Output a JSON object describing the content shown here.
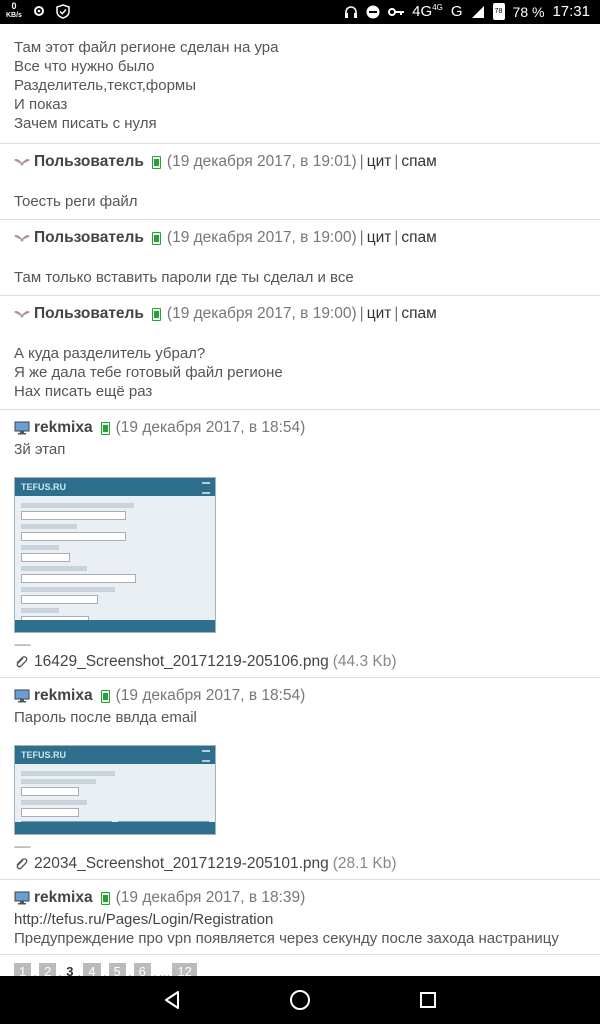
{
  "status_bar": {
    "speed_value": "0",
    "speed_unit": "KB/s",
    "network": "4G",
    "network_small": "4G",
    "carrier_letter": "G",
    "battery_level": "78",
    "battery_percent": "78 %",
    "time": "17:31",
    "icons": [
      "settings-icon",
      "shield-icon",
      "headphones-icon",
      "do-not-disturb-icon",
      "key-icon",
      "signal-icon",
      "battery-icon"
    ]
  },
  "posts": [
    {
      "text_lines": [
        "Там этот файл регионе сделан на ура",
        "Все что нужно было",
        "Разделитель,текст,формы",
        "И показ",
        "Зачем писать с нуля"
      ]
    },
    {
      "author": "Пользователь",
      "date": "(19 декабря 2017, в 19:01)",
      "actions": [
        "цит",
        "спам"
      ],
      "message_lines": [
        "Тоесть реги файл"
      ]
    },
    {
      "author": "Пользователь",
      "date": "(19 декабря 2017, в 19:00)",
      "actions": [
        "цит",
        "спам"
      ],
      "message_lines": [
        "Там только вставить пароли где ты сделал и все"
      ]
    },
    {
      "author": "Пользователь",
      "date": "(19 декабря 2017, в 19:00)",
      "actions": [
        "цит",
        "спам"
      ],
      "message_lines": [
        "А куда разделитель убрал?",
        "Я же дала тебе готовый файл регионе",
        "Нах писать ещё раз"
      ]
    },
    {
      "author": "rekmixa",
      "date": "(19 декабря 2017, в 18:54)",
      "message_lines": [
        "3й этап"
      ],
      "thumb_brand": "TEFUS.RU",
      "dashes": "------",
      "attachment_name": "16429_Screenshot_20171219-205106.png",
      "attachment_size": "(44.3 Kb)"
    },
    {
      "author": "rekmixa",
      "date": "(19 декабря 2017, в 18:54)",
      "message_lines": [
        "Пароль после ввлда email"
      ],
      "thumb_brand": "TEFUS.RU",
      "dashes": "------",
      "attachment_name": "22034_Screenshot_20171219-205101.png",
      "attachment_size": "(28.1 Kb)"
    },
    {
      "author": "rekmixa",
      "date": "(19 декабря 2017, в 18:39)",
      "message_lines": [
        "http://tefus.ru/Pages/Login/Registration",
        "Предупреждение про vpn появляется через секунду после захода настраницу"
      ]
    }
  ],
  "pagination": {
    "pages": [
      "1",
      "2",
      "3",
      "4",
      "5",
      "6"
    ],
    "current": "3",
    "ellipsis": "...",
    "last": "12"
  },
  "nav_bar": {
    "icons": [
      "back-icon",
      "home-icon",
      "recents-icon"
    ]
  }
}
